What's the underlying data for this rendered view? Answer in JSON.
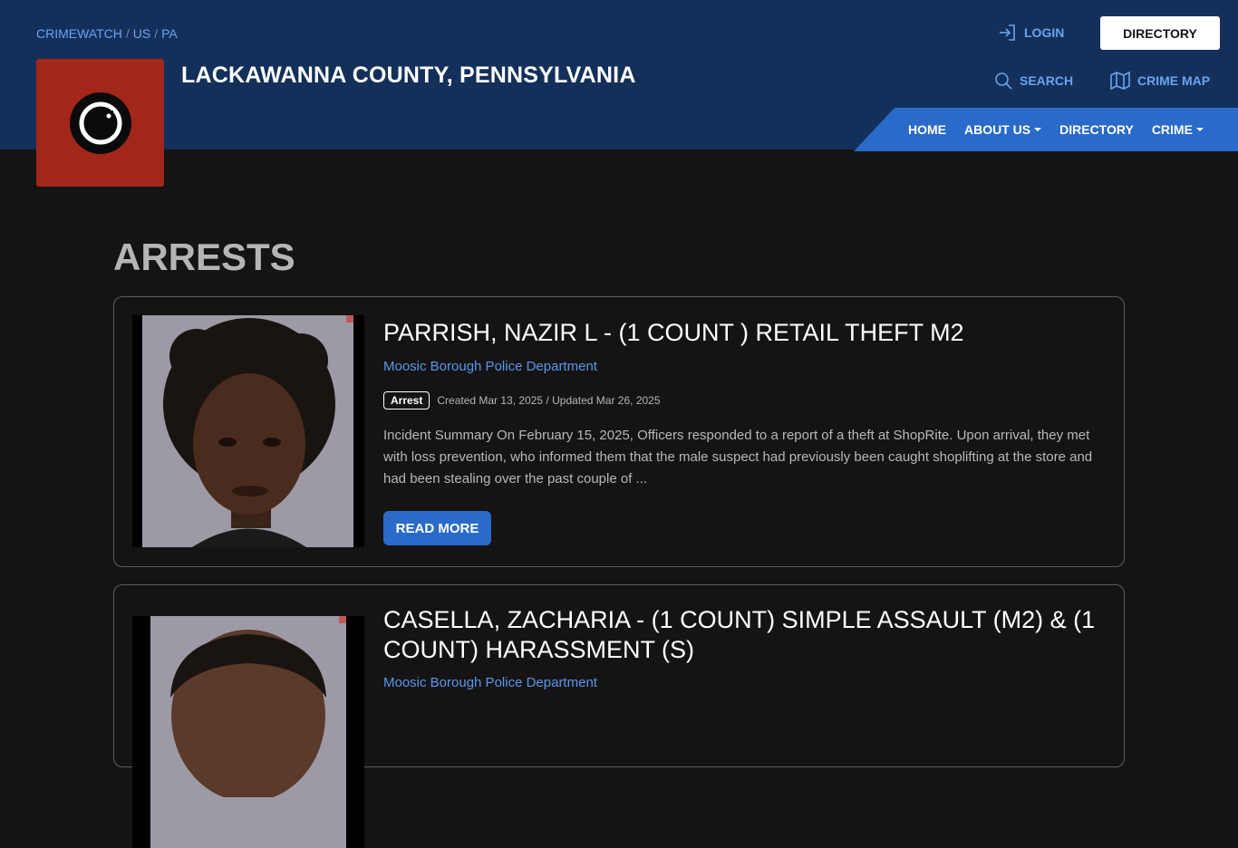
{
  "breadcrumb": {
    "items": [
      "CRIMEWATCH",
      "US",
      "PA"
    ],
    "separator": "/"
  },
  "site": {
    "title": "LACKAWANNA COUNTY, PENNSYLVANIA"
  },
  "header": {
    "login_label": "LOGIN",
    "directory_button": "DIRECTORY",
    "search_label": "SEARCH",
    "crime_map_label": "CRIME MAP"
  },
  "nav": {
    "items": [
      {
        "label": "HOME",
        "dropdown": false
      },
      {
        "label": "ABOUT US",
        "dropdown": true
      },
      {
        "label": "DIRECTORY",
        "dropdown": false
      },
      {
        "label": "CRIME",
        "dropdown": true
      }
    ]
  },
  "page": {
    "heading": "ARRESTS"
  },
  "arrests": [
    {
      "title": "PARRISH, NAZIR L - (1 COUNT ) RETAIL THEFT M2",
      "agency": "Moosic Borough Police Department",
      "badge": "Arrest",
      "meta": "Created Mar 13, 2025 / Updated Mar 26, 2025",
      "summary": "Incident Summary On February 15, 2025, Officers responded to a report of a theft at ShopRite. Upon arrival, they met with loss prevention, who informed them that the male suspect had previously been caught shoplifting at the store and had been stealing over the past couple of ...",
      "read_more": "READ MORE"
    },
    {
      "title": "CASELLA, ZACHARIA - (1 COUNT) SIMPLE ASSAULT (M2) & (1 COUNT) HARASSMENT (S)",
      "agency": "Moosic Borough Police Department"
    }
  ],
  "colors": {
    "header_bg": "#14305a",
    "accent": "#2a6ac8",
    "link": "#6aa3f0",
    "logo_bg": "#a3261a",
    "page_bg": "#141414"
  }
}
